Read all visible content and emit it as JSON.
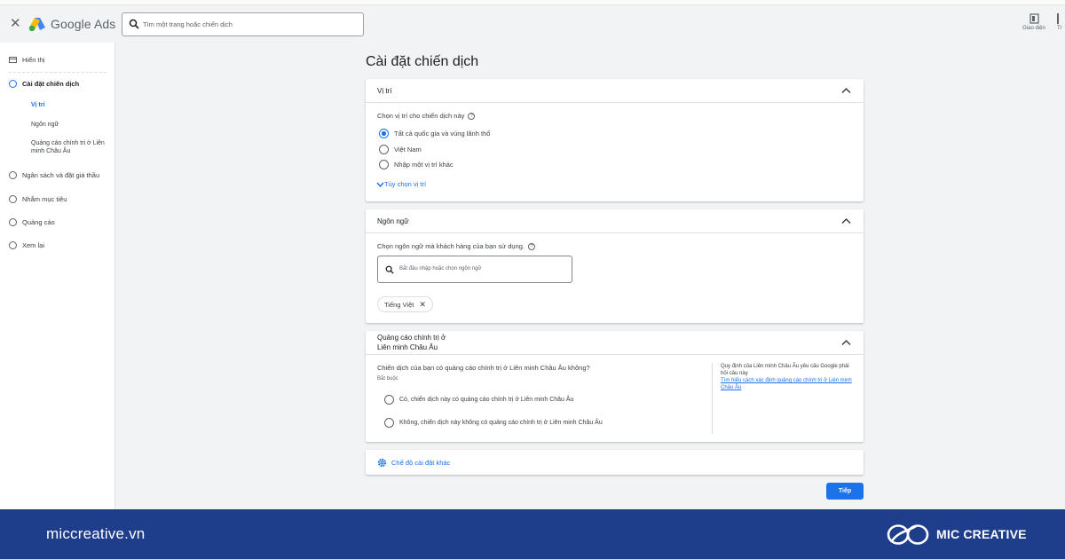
{
  "header": {
    "close_label": "✕",
    "brand": "Google Ads",
    "search_placeholder": "Tìm một trang hoặc chiến dịch",
    "tools": [
      {
        "label": "Giao diện",
        "icon": "layout-icon"
      },
      {
        "label": "Tr",
        "icon": "tools-icon"
      }
    ]
  },
  "sidebar": {
    "items": [
      {
        "label": "Hiển thị",
        "icon": "display-icon"
      },
      {
        "label": "Cài đặt chiến dịch",
        "active": true
      },
      {
        "label": "Ngân sách và đặt giá thầu"
      },
      {
        "label": "Nhắm mục tiêu"
      },
      {
        "label": "Quảng cáo"
      },
      {
        "label": "Xem lại"
      }
    ],
    "subitems": [
      {
        "label": "Vị trí",
        "active": true
      },
      {
        "label": "Ngôn ngữ"
      },
      {
        "label": "Quảng cáo chính trị ở Liên minh Châu Âu"
      }
    ]
  },
  "main": {
    "title": "Cài đặt chiến dịch",
    "location": {
      "title": "Vị trí",
      "prompt": "Chọn vị trí cho chiến dịch này",
      "options": [
        {
          "label": "Tất cả quốc gia và vùng lãnh thổ",
          "checked": true
        },
        {
          "label": "Việt Nam",
          "checked": false
        },
        {
          "label": "Nhập một vị trí khác",
          "checked": false
        }
      ],
      "more_link": "Tùy chọn vị trí"
    },
    "language": {
      "title": "Ngôn ngữ",
      "prompt": "Chọn ngôn ngữ mà khách hàng của bạn sử dụng.",
      "search_placeholder": "Bắt đầu nhập hoặc chọn ngôn ngữ",
      "chip": "Tiếng Việt"
    },
    "eu_political": {
      "title_line1": "Quảng cáo chính trị ở",
      "title_line2": "Liên minh Châu Âu",
      "question": "Chiến dịch của bạn có quảng cáo chính trị ở Liên minh Châu Âu không?",
      "required": "Bắt buộc",
      "options": [
        {
          "label": "Có, chiến dịch này có quảng cáo chính trị ở Liên minh Châu Âu"
        },
        {
          "label": "Không, chiến dịch này không có quảng cáo chính trị ở Liên minh Châu Âu"
        }
      ],
      "note": "Quy định của Liên minh Châu Âu yêu cầu Google phải hỏi câu này",
      "note_link": "Tìm hiểu cách xác định quảng cáo chính trị ở Liên minh Châu Âu"
    },
    "other_settings": "Chế độ cài đặt khác",
    "next_button": "Tiếp"
  },
  "footer": {
    "site": "miccreative.vn",
    "brand": "MIC CREATIVE"
  },
  "colors": {
    "accent": "#1a73e8",
    "footer_bg": "#1e3d8a"
  }
}
